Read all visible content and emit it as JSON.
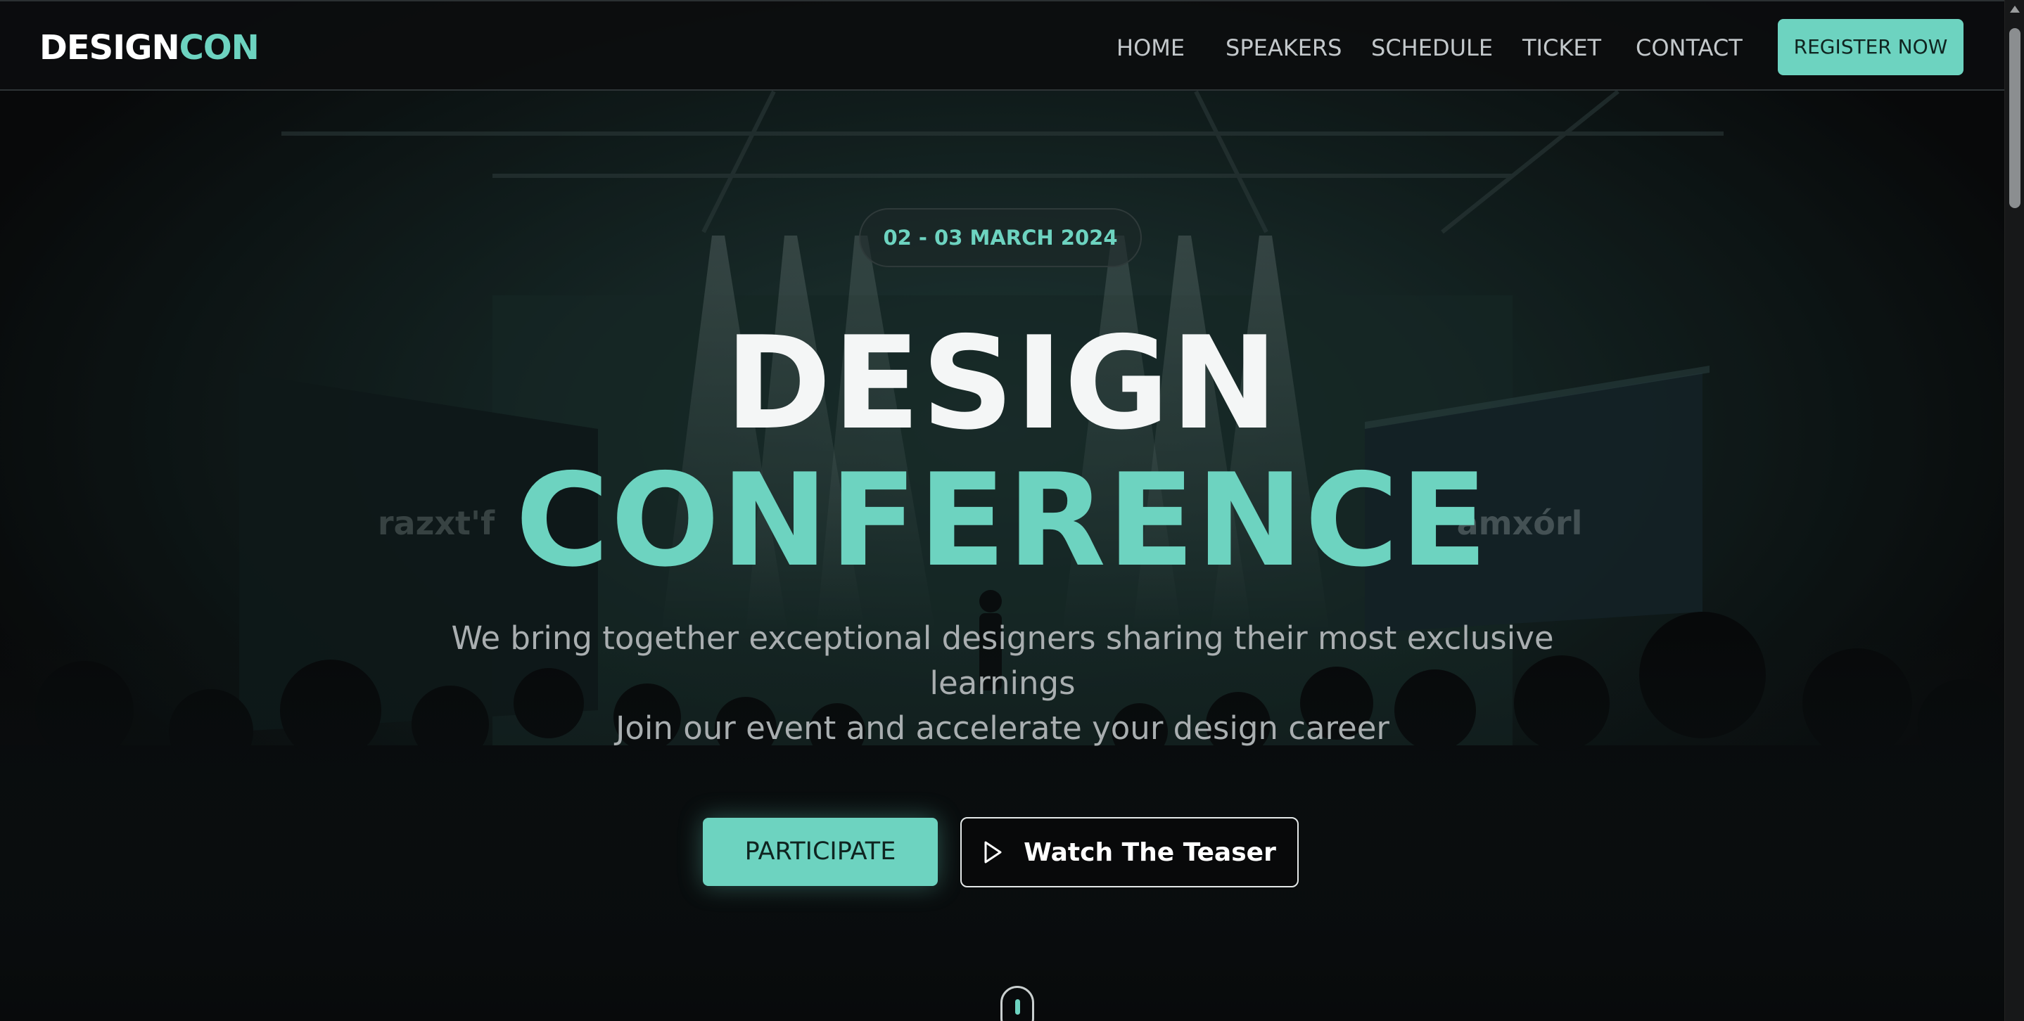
{
  "navbar": {
    "logo_primary": "DESIGN",
    "logo_accent": "CON",
    "links": [
      "HOME",
      "SPEAKERS",
      "SCHEDULE",
      "TICKET",
      "CONTACT"
    ],
    "register_label": "REGISTER NOW"
  },
  "hero": {
    "date": "02 - 03 MARCH 2024",
    "title_line1": "DESIGN",
    "title_line2": "CONFERENCE",
    "subtitle_line1": "We bring together exceptional designers sharing their most exclusive learnings",
    "subtitle_line2": "Join our event and accelerate your design career",
    "participate_label": "PARTICIPATE",
    "teaser_label": "Watch The Teaser",
    "background_screen_left": "razxt'f",
    "background_screen_right": "amxórl"
  },
  "icons": {
    "play": "play-icon",
    "scroll": "mouse-scroll-icon"
  },
  "colors": {
    "accent": "#6dd3c0",
    "background": "#0c0e0f",
    "nav_text": "#c3c8cb",
    "subtitle_text": "#a9aeb0"
  }
}
